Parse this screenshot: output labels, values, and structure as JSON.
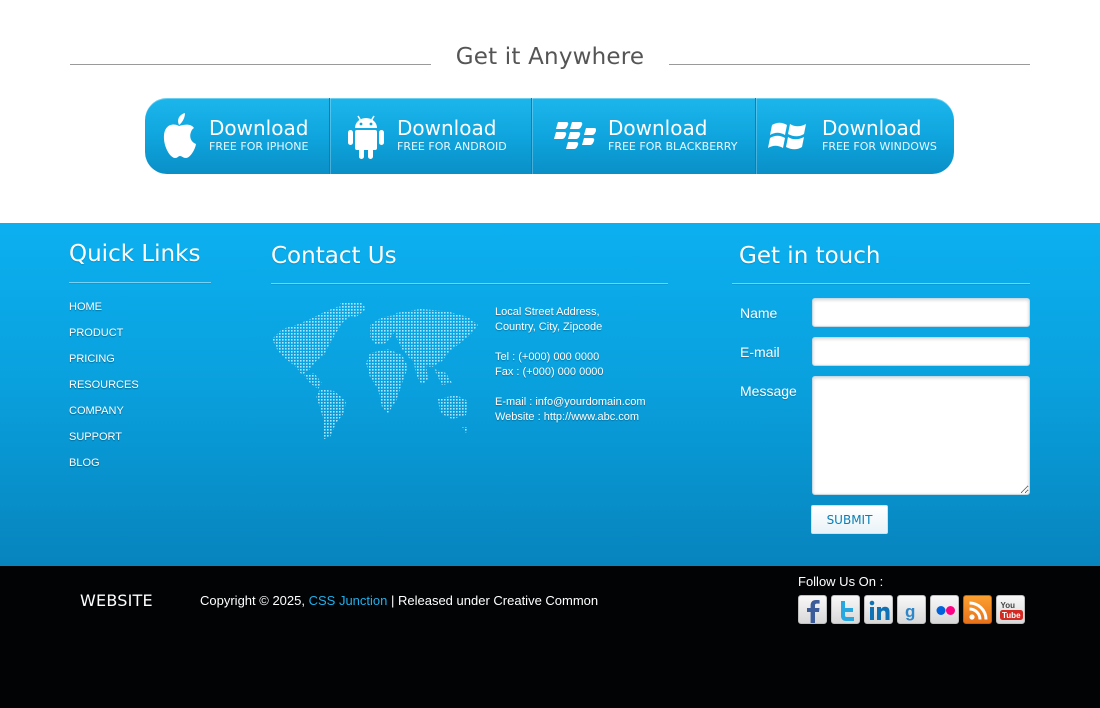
{
  "anywhere": {
    "title": "Get it Anywhere",
    "downloads": [
      {
        "platform": "iphone",
        "icon": "apple-icon",
        "label": "Download",
        "sub": "FREE FOR IPHONE"
      },
      {
        "platform": "android",
        "icon": "android-icon",
        "label": "Download",
        "sub": "FREE FOR ANDROID"
      },
      {
        "platform": "blackberry",
        "icon": "blackberry-icon",
        "label": "Download",
        "sub": "FREE FOR BLACKBERRY"
      },
      {
        "platform": "windows",
        "icon": "windows-icon",
        "label": "Download",
        "sub": "FREE FOR WINDOWS"
      }
    ]
  },
  "quick_links": {
    "title": "Quick Links",
    "items": [
      "HOME",
      "PRODUCT",
      "PRICING",
      "RESOURCES",
      "COMPANY",
      "SUPPORT",
      "BLOG"
    ]
  },
  "contact": {
    "title": "Contact Us",
    "address_line1": "Local Street Address,",
    "address_line2": "Country, City, Zipcode",
    "tel": "Tel : (+000) 000 0000",
    "fax": "Fax : (+000) 000 0000",
    "email": "E-mail : info@yourdomain.com",
    "website": "Website : http://www.abc.com"
  },
  "touch": {
    "title": "Get in touch",
    "name_label": "Name",
    "email_label": "E-mail",
    "message_label": "Message",
    "name_value": "",
    "email_value": "",
    "message_value": "",
    "submit_label": "SUBMIT"
  },
  "footer": {
    "logo": "WEBSITE",
    "copyright_prefix": "Copyright © 2025,",
    "copyright_link": "CSS Junction",
    "copyright_suffix": "| Released under Creative Common",
    "follow_label": "Follow Us On :",
    "social": [
      "facebook-icon",
      "twitter-icon",
      "linkedin-icon",
      "google-icon",
      "flickr-icon",
      "rss-icon",
      "youtube-icon"
    ]
  },
  "colors": {
    "brand_blue": "#0ea3dc",
    "link_blue": "#1fb0ec",
    "footer_black": "#010305"
  }
}
